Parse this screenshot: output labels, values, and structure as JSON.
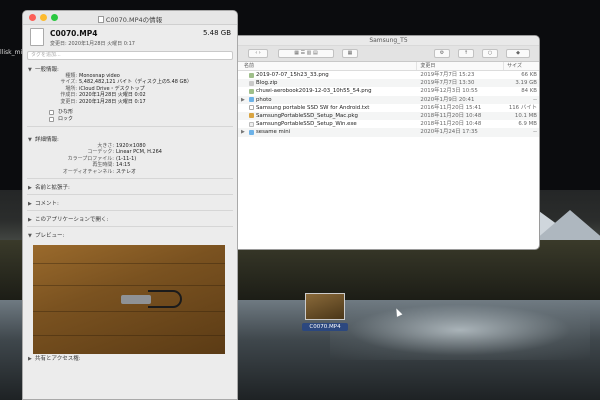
{
  "desktop": {
    "left_label": "llisk_mi"
  },
  "info_window": {
    "title": "C0070.MP4の情報",
    "file_name": "C0070.MP4",
    "file_size": "5.48 GB",
    "modified": "変更日: 2020年1月28日 火曜日 0:17",
    "tags_placeholder": "タグを追加...",
    "general": {
      "heading": "一般情報:",
      "rows": [
        {
          "k": "種類:",
          "v": "Monosnap video"
        },
        {
          "k": "サイズ:",
          "v": "5,482,482,121 バイト（ディスク上の5.48 GB）"
        },
        {
          "k": "場所:",
          "v": "iCloud Drive・デスクトップ"
        },
        {
          "k": "作成日:",
          "v": "2020年1月28日 火曜日 0:02"
        },
        {
          "k": "変更日:",
          "v": "2020年1月28日 火曜日 0:17"
        }
      ],
      "checkbox1": "ひな形",
      "checkbox2": "ロック"
    },
    "more": {
      "heading": "詳細情報:",
      "rows": [
        {
          "k": "大きさ:",
          "v": "1920×1080"
        },
        {
          "k": "コーデック:",
          "v": "Linear PCM, H.264"
        },
        {
          "k": "カラープロファイル:",
          "v": "(1-11-1)"
        },
        {
          "k": "再生時間:",
          "v": "14:15"
        },
        {
          "k": "オーディオチャンネル:",
          "v": "ステレオ"
        }
      ]
    },
    "name_ext": "名前と拡張子:",
    "comments": "コメント:",
    "open_with": "このアプリケーションで開く:",
    "preview": "プレビュー:",
    "sharing": "共有とアクセス権:"
  },
  "finder": {
    "title": "Samsung_T5",
    "columns": {
      "name": "名前",
      "date": "変更日",
      "size": "サイズ"
    },
    "rows": [
      {
        "icon": "png",
        "name": "2019-07-07_15h23_33.png",
        "date": "2019年7月7日 15:23",
        "size": "66 KB"
      },
      {
        "icon": "zip",
        "name": "Blog.zip",
        "date": "2019年7月7日 13:30",
        "size": "3.19 GB"
      },
      {
        "icon": "png",
        "name": "chuwi-aerobook2019-12-03_10h55_54.png",
        "date": "2019年12月3日 10:55",
        "size": "84 KB"
      },
      {
        "icon": "folder",
        "name": "photo",
        "date": "2020年1月9日 20:41",
        "size": "--"
      },
      {
        "icon": "txt",
        "name": "Samsung portable SSD SW for Android.txt",
        "date": "2016年11月20日 15:41",
        "size": "116 バイト"
      },
      {
        "icon": "pkg",
        "name": "SamsungPortableSSD_Setup_Mac.pkg",
        "date": "2018年11月20日 10:48",
        "size": "10.1 MB"
      },
      {
        "icon": "exe",
        "name": "SamsungPortableSSD_Setup_Win.exe",
        "date": "2018年11月20日 10:48",
        "size": "6.9 MB"
      },
      {
        "icon": "folder",
        "name": "sesame mini",
        "date": "2020年1月24日 17:35",
        "size": "--"
      }
    ]
  },
  "drag_file": {
    "label": "C0070.MP4"
  }
}
